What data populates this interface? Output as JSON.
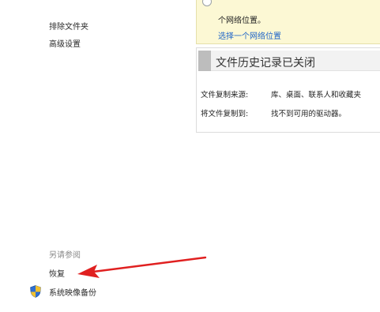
{
  "sidebar": {
    "links": [
      {
        "label": "排除文件夹"
      },
      {
        "label": "高级设置"
      }
    ]
  },
  "notification": {
    "text": "个网络位置。",
    "link_label": "选择一个网络位置"
  },
  "status_panel": {
    "title": "文件历史记录已关闭",
    "rows": [
      {
        "label": "文件复制来源:",
        "value": "库、桌面、联系人和收藏夹"
      },
      {
        "label": "将文件复制到:",
        "value": "找不到可用的驱动器。"
      }
    ]
  },
  "see_also": {
    "heading": "另请参阅",
    "links": [
      {
        "label": "恢复"
      },
      {
        "label": "系统映像备份"
      }
    ]
  },
  "colors": {
    "arrow": "#e02020",
    "notice_bg": "#fcf8d4",
    "link": "#1e64c8"
  },
  "icons": {
    "notice": "info-circle-icon",
    "status": "file-history-icon",
    "shield": "uac-shield-icon",
    "annotation": "red-arrow"
  }
}
